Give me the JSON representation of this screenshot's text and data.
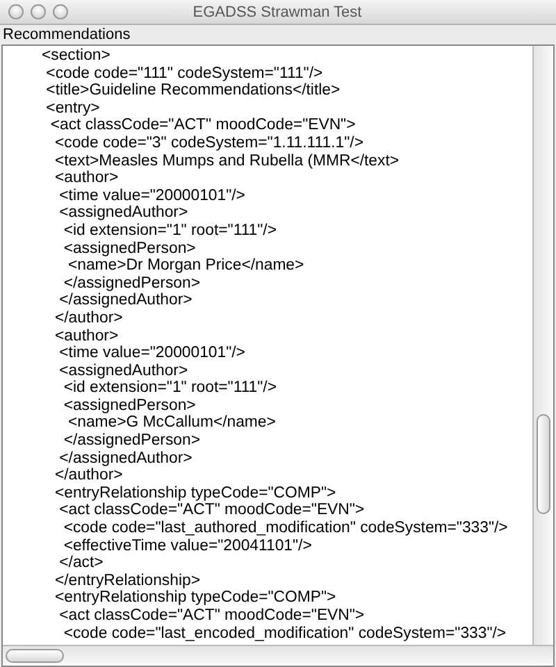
{
  "window": {
    "title": "EGADSS Strawman Test"
  },
  "panel": {
    "label": "Recommendations"
  },
  "lines": [
    "<section>",
    " <code code=\"111\" codeSystem=\"111\"/>",
    " <title>Guideline Recommendations</title>",
    " <entry>",
    "  <act classCode=\"ACT\" moodCode=\"EVN\">",
    "   <code code=\"3\" codeSystem=\"1.11.111.1\"/>",
    "   <text>Measles Mumps and Rubella (MMR</text>",
    "   <author>",
    "    <time value=\"20000101\"/>",
    "    <assignedAuthor>",
    "     <id extension=\"1\" root=\"111\"/>",
    "     <assignedPerson>",
    "      <name>Dr Morgan Price</name>",
    "     </assignedPerson>",
    "    </assignedAuthor>",
    "   </author>",
    "   <author>",
    "    <time value=\"20000101\"/>",
    "    <assignedAuthor>",
    "     <id extension=\"1\" root=\"111\"/>",
    "     <assignedPerson>",
    "      <name>G McCallum</name>",
    "     </assignedPerson>",
    "    </assignedAuthor>",
    "   </author>",
    "   <entryRelationship typeCode=\"COMP\">",
    "    <act classCode=\"ACT\" moodCode=\"EVN\">",
    "     <code code=\"last_authored_modification\" codeSystem=\"333\"/>",
    "     <effectiveTime value=\"20041101\"/>",
    "    </act>",
    "   </entryRelationship>",
    "   <entryRelationship typeCode=\"COMP\">",
    "    <act classCode=\"ACT\" moodCode=\"EVN\">",
    "     <code code=\"last_encoded_modification\" codeSystem=\"333\"/>"
  ]
}
